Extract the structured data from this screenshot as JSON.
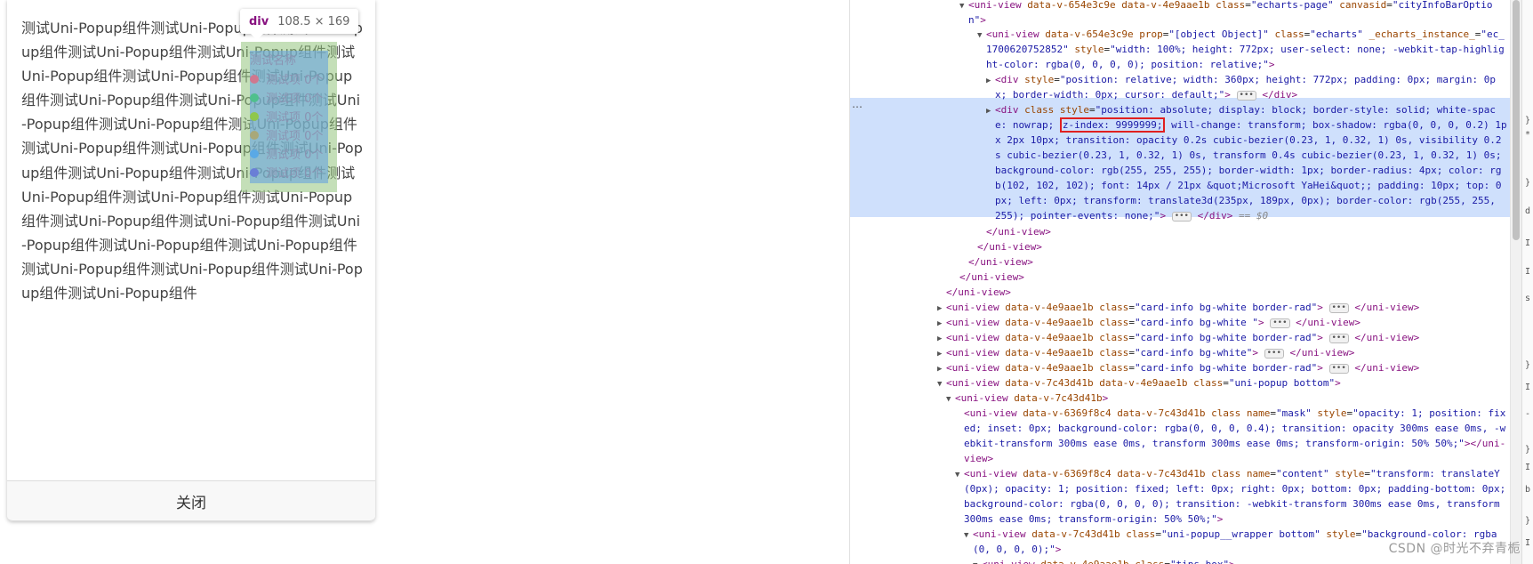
{
  "popup": {
    "text": "测试Uni-Popup组件测试Uni-Popup组件测试Uni-Popup组件测试Uni-Popup组件测试Uni-Popup组件测试Uni-Popup组件测试Uni-Popup组件测试Uni-Popup组件测试Uni-Popup组件测试Uni-Popup组件测试Uni-Popup组件测试Uni-Popup组件测试Uni-Popup组件测试Uni-Popup组件测试Uni-Popup组件测试Uni-Popup组件测试Uni-Popup组件测试Uni-Popup组件测试Uni-Popup组件测试Uni-Popup组件测试Uni-Popup组件测试Uni-Popup组件测试Uni-Popup组件测试Uni-Popup组件测试Uni-Popup组件测试Uni-Popup组件测试Uni-Popup组件测试Uni-Popup组件测试Uni-Popup组件测试Uni-Popup组件",
    "close_label": "关闭"
  },
  "highlight": {
    "tag": "div",
    "size": "108.5 × 169"
  },
  "tooltip": {
    "name": "测试名称",
    "items": [
      {
        "label": "测试项 0个",
        "color": "#d0788f"
      },
      {
        "label": "测试项 0个",
        "color": "#4fc08d"
      },
      {
        "label": "测试项 0个",
        "color": "#8fc74d"
      },
      {
        "label": "测试项 0个",
        "color": "#a8a87a"
      },
      {
        "label": "测试项 0个",
        "color": "#5aa9e6"
      },
      {
        "label": "测试项 0个",
        "color": "#6a7fd6"
      }
    ]
  },
  "devtools": {
    "highlight_color": "#cfe0fc",
    "z_index_text": "z-index: 9999999;",
    "eq0": "== $0"
  },
  "watermark": "CSDN @时光不弃青栀"
}
